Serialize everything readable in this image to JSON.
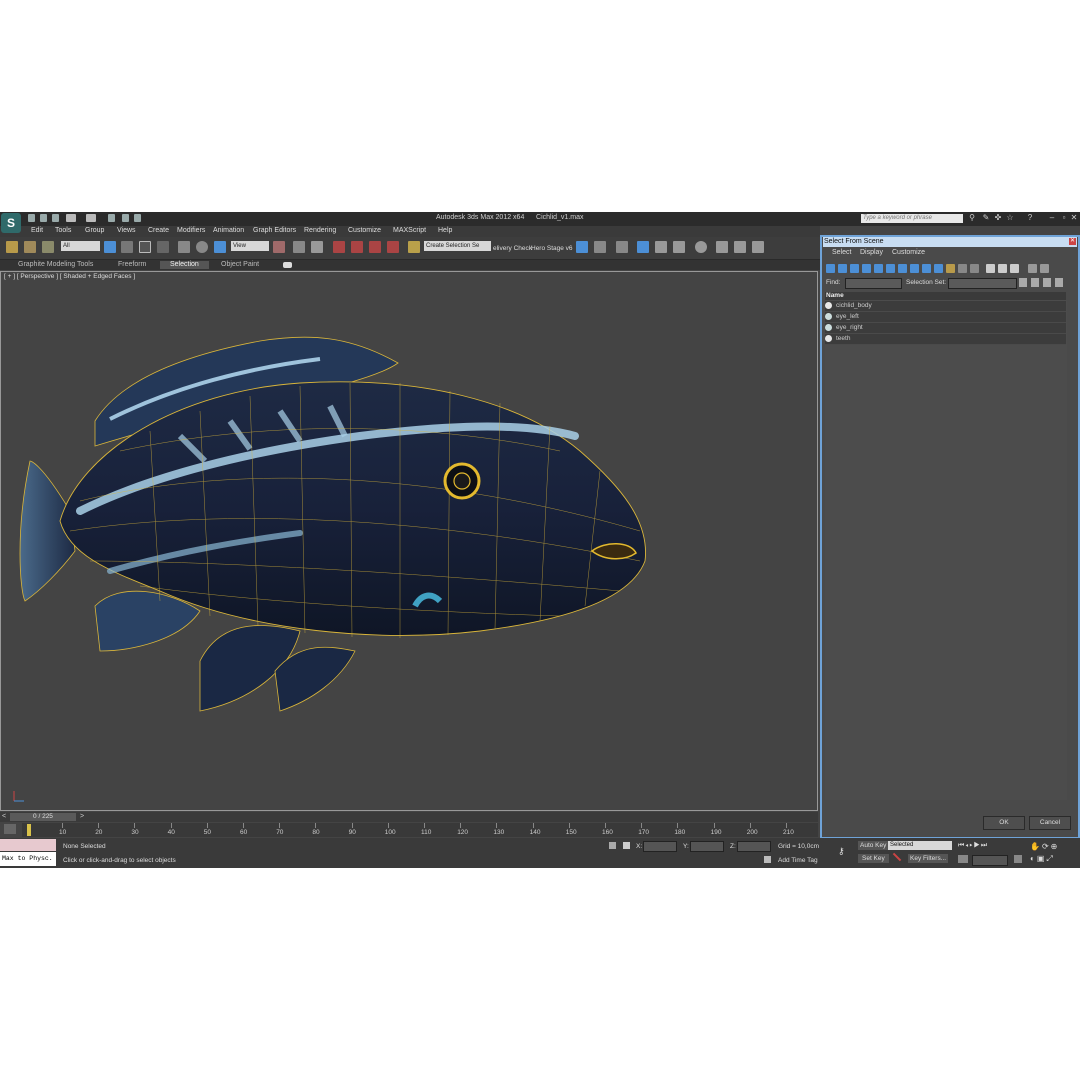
{
  "window": {
    "title": "Autodesk 3ds Max  2012 x64",
    "file": "Cichlid_v1.max",
    "search_placeholder": "Type a keyword or phrase"
  },
  "menu": [
    "Edit",
    "Tools",
    "Group",
    "Views",
    "Create",
    "Modifiers",
    "Animation",
    "Graph Editors",
    "Rendering",
    "Customize",
    "MAXScript",
    "Help"
  ],
  "toolbar": {
    "selection_filter": "All",
    "coord_system": "View",
    "selection_set": "Create Selection Se",
    "delivery_check": "elivery Check",
    "hero_stage": "Hero Stage v6"
  },
  "ribbon_tabs": [
    "Graphite Modeling Tools",
    "Freeform",
    "Selection",
    "Object Paint"
  ],
  "viewport": {
    "label": "[ + ] [ Perspective ] [ Shaded + Edged Faces ]"
  },
  "dialog": {
    "title": "Select From Scene",
    "menu": [
      "Select",
      "Display",
      "Customize"
    ],
    "find_label": "Find:",
    "selection_set_label": "Selection Set:",
    "column_name": "Name",
    "objects": [
      "cichlid_body",
      "eye_left",
      "eye_right",
      "teeth"
    ],
    "ok": "OK",
    "cancel": "Cancel"
  },
  "timeline": {
    "frame": "0 / 225",
    "ticks": [
      "10",
      "20",
      "30",
      "40",
      "50",
      "60",
      "70",
      "80",
      "90",
      "100",
      "110",
      "120",
      "130",
      "140",
      "150",
      "160",
      "170",
      "180",
      "190",
      "200",
      "210"
    ]
  },
  "status": {
    "maxscript": "Max to Physc.",
    "selected": "None Selected",
    "prompt": "Click or click-and-drag to select objects",
    "x_label": "X:",
    "y_label": "Y:",
    "z_label": "Z:",
    "grid": "Grid = 10,0cm",
    "add_time_tag": "Add Time Tag",
    "auto_key": "Auto Key",
    "set_key": "Set Key",
    "key_mode": "Selected",
    "key_filters": "Key Filters..."
  },
  "colors": {
    "background": "#444444",
    "wireframe": "#d9b53a",
    "dialog_border": "#6fa3d8",
    "selection_active": "#4c8fd6"
  }
}
